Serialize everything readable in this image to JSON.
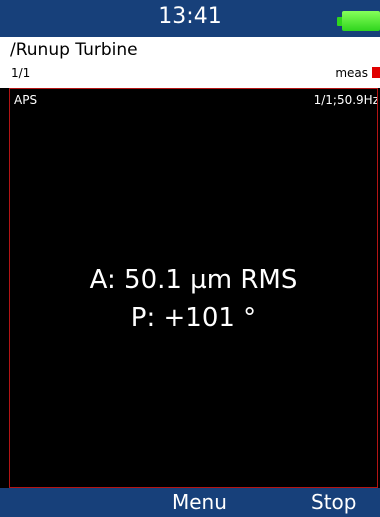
{
  "status_bar": {
    "time": "13:41",
    "battery_icon": "battery-full-icon",
    "battery_color": "#2fd51d",
    "background": "#17407a"
  },
  "header": {
    "breadcrumb": "/Runup Turbine",
    "page_indicator": "1/1",
    "meas_label": "meas",
    "meas_indicator_color": "#e00000"
  },
  "panel": {
    "title": "APS",
    "info": "1/1;50.9Hz",
    "amplitude": "A: 50.1 µm RMS",
    "phase": "P: +101 °",
    "border_color": "#b31414"
  },
  "softkeys": {
    "menu_label": "Menu",
    "stop_label": "Stop"
  }
}
